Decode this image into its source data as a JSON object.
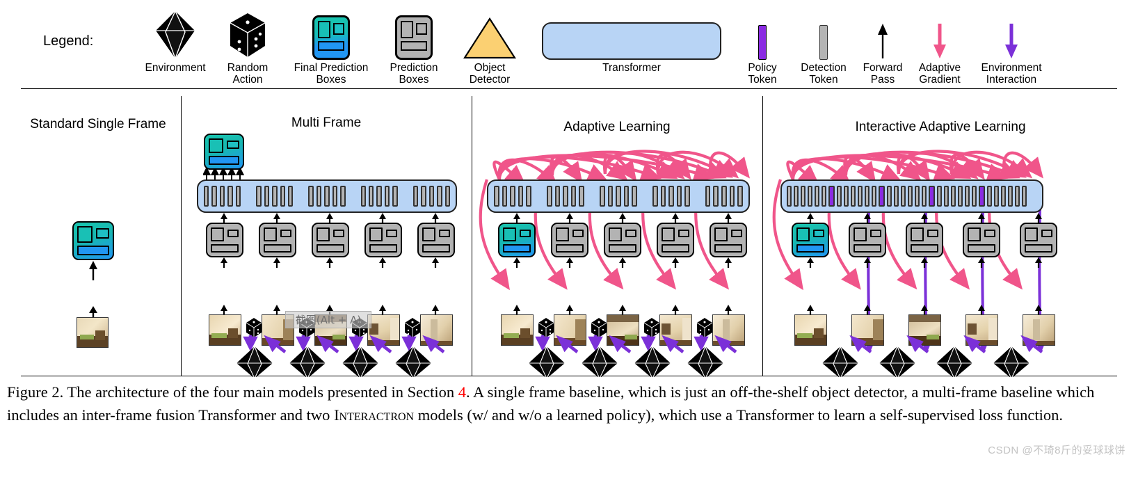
{
  "figure": {
    "legend_label": "Legend:",
    "legend_items": [
      {
        "name": "environment",
        "label": "Environment",
        "icon": "octahedron-icon"
      },
      {
        "name": "random-action",
        "label": "Random\nAction",
        "icon": "dice-icon"
      },
      {
        "name": "final-pred-boxes",
        "label": "Final Prediction\nBoxes",
        "icon": "final-prediction-boxes-icon"
      },
      {
        "name": "prediction-boxes",
        "label": "Prediction\nBoxes",
        "icon": "prediction-boxes-icon"
      },
      {
        "name": "object-detector",
        "label": "Object\nDetector",
        "icon": "triangle-icon"
      },
      {
        "name": "transformer",
        "label": "Transformer",
        "icon": "rounded-bar-icon"
      },
      {
        "name": "policy-token",
        "label": "Policy\nToken",
        "icon": "policy-token-icon"
      },
      {
        "name": "detection-token",
        "label": "Detection\nToken",
        "icon": "detection-token-icon"
      },
      {
        "name": "forward-pass",
        "label": "Forward\nPass",
        "icon": "arrow-up-icon"
      },
      {
        "name": "adaptive-gradient",
        "label": "Adaptive\nGradient",
        "icon": "arrow-down-pink-icon"
      },
      {
        "name": "env-interaction",
        "label": "Environment\nInteraction",
        "icon": "arrow-down-purple-icon"
      }
    ],
    "panels": [
      {
        "name": "standard-single-frame",
        "title": "Standard Single Frame",
        "columns": 1
      },
      {
        "name": "multi-frame",
        "title": "Multi Frame",
        "columns": 5
      },
      {
        "name": "adaptive-learning",
        "title": "Adaptive Learning",
        "columns": 5
      },
      {
        "name": "interactive-adaptive-learning",
        "title": "Interactive Adaptive Learning",
        "columns": 5
      }
    ],
    "caption": {
      "part1": "Figure 2.  The architecture of the four main models presented in Section ",
      "section_number": "4",
      "part2": ".  A single frame baseline, which is just an off-the-shelf object detector, a multi-frame baseline which includes an inter-frame fusion Transformer and two ",
      "smallcaps": "Interactron",
      "part3": " models (w/ and w/o a learned policy), which use a Transformer to learn a self-supervised loss function."
    },
    "tooltip": {
      "text": "截图(Alt + A)"
    },
    "watermark": {
      "text": "CSDN @不琦8斤的妥球球饼"
    },
    "colors": {
      "transformer_fill": "#b8d4f5",
      "detector_fill": "#fbd072",
      "policy_token": "#8a2be2",
      "detection_token": "#b4b4b4",
      "adaptive_gradient": "#f0558a",
      "environment_interaction": "#7b30d8",
      "final_box_teal": "#19c5ae",
      "final_box_blue": "#2196f3",
      "section_ref": "#ff0000"
    }
  }
}
